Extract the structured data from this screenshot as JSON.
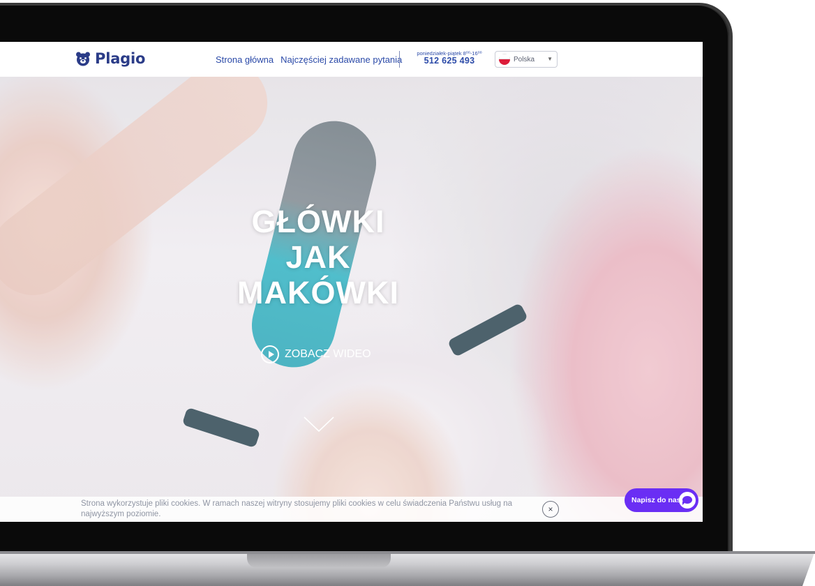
{
  "header": {
    "logo_text": "Plagio",
    "nav": {
      "home": "Strona główna",
      "faq": "Najczęściej zadawane pytania"
    },
    "contact": {
      "hours": "poniedziałek-piątek 8⁰⁰-16⁰⁰",
      "phone": "512 625 493"
    },
    "language": {
      "selected": "Polska",
      "icon": "poland-flag-icon"
    }
  },
  "hero": {
    "title_lines": [
      "GŁÓWKI",
      "JAK",
      "MAKÓWKI"
    ],
    "video_button": "ZOBACZ WIDEO",
    "scroll_icon": "chevron-down-icon"
  },
  "cookie_bar": {
    "text": "Strona wykorzystuje pliki cookies. W ramach naszej witryny stosujemy pliki cookies w celu świadczenia Państwu usług na najwyższym poziomie.",
    "close_label": "×"
  },
  "chat": {
    "label": "Napisz do nas",
    "icon": "chat-bubble-icon",
    "color": "#6a2ef4"
  },
  "colors": {
    "brand_blue": "#2b3c88",
    "nav_blue": "#2b4aa8",
    "chat_purple": "#6a2ef4"
  }
}
